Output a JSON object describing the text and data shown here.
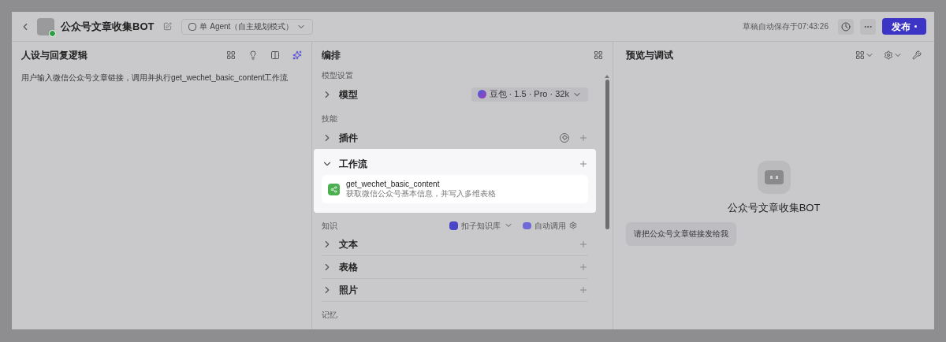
{
  "header": {
    "bot_name": "公众号文章收集BOT",
    "mode": "单 Agent（自主规划模式）",
    "autosave": "草稿自动保存于07:43:26",
    "publish": "发布"
  },
  "persona": {
    "title": "人设与回复逻辑",
    "prompt": "用户输入微信公众号文章链接，调用并执行get_wechet_basic_content工作流"
  },
  "arrange": {
    "title": "编排",
    "sections": [
      {
        "heading": "模型设置",
        "rows": [
          {
            "kind": "model",
            "label": "模型",
            "expanded": false,
            "chip": "豆包 · 1.5 · Pro · 32k"
          }
        ]
      },
      {
        "heading": "技能",
        "rows": [
          {
            "kind": "plugin",
            "label": "插件",
            "expanded": false
          },
          {
            "kind": "workflow",
            "label": "工作流",
            "expanded": true,
            "highlighted": true,
            "items": [
              {
                "name": "get_wechet_basic_content",
                "desc": "获取微信公众号基本信息，并写入多维表格"
              }
            ]
          }
        ]
      },
      {
        "heading": "知识",
        "kb": "扣子知识库",
        "auto": "自动调用",
        "rows": [
          {
            "kind": "plain",
            "label": "文本",
            "expanded": false
          },
          {
            "kind": "plain",
            "label": "表格",
            "expanded": false
          },
          {
            "kind": "plain",
            "label": "照片",
            "expanded": false
          }
        ]
      },
      {
        "heading": "记忆"
      }
    ]
  },
  "preview": {
    "title": "预览与调试",
    "bot_name": "公众号文章收集BOT",
    "opener": "请把公众号文章链接发给我"
  }
}
